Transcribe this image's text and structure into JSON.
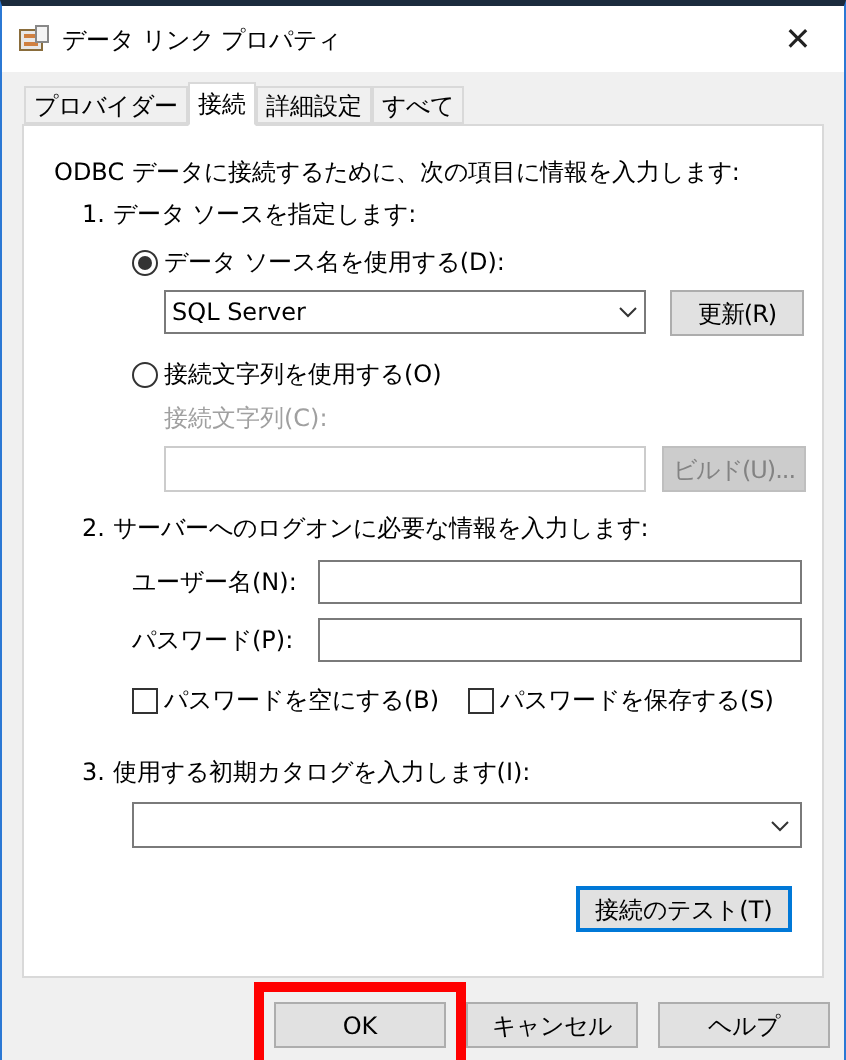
{
  "window": {
    "title": "データ リンク プロパティ",
    "close": "✕"
  },
  "tabs": [
    {
      "label": "プロバイダー",
      "selected": false
    },
    {
      "label": "接続",
      "selected": true
    },
    {
      "label": "詳細設定",
      "selected": false
    },
    {
      "label": "すべて",
      "selected": false
    }
  ],
  "intro": "ODBC データに接続するために、次の項目に情報を入力します:",
  "step1": {
    "title": "1. データ ソースを指定します:",
    "dsn_option": {
      "label": "データ ソース名を使用する(D):",
      "selected": true
    },
    "dsn_combo": {
      "value": "SQL Server",
      "disabled": false
    },
    "refresh_button": {
      "label": "更新(R)",
      "disabled": false
    },
    "connstr_option": {
      "label": "接続文字列を使用する(O)",
      "selected": false
    },
    "connstr_label": {
      "text": "接続文字列(C):",
      "disabled": true
    },
    "connstr_field": {
      "disabled": true
    },
    "build_button": {
      "label": "ビルド(U)...",
      "disabled": true
    }
  },
  "step2": {
    "title": "2. サーバーへのログオンに必要な情報を入力します:",
    "fields": [
      {
        "label": "ユーザー名(N):"
      },
      {
        "label": "パスワード(P):"
      }
    ],
    "checkboxes": [
      {
        "label": "パスワードを空にする(B)",
        "checked": false
      },
      {
        "label": "パスワードを保存する(S)",
        "checked": false
      }
    ]
  },
  "step3": {
    "title": "3. 使用する初期カタログを入力します(I):"
  },
  "test_button": {
    "label": "接続のテスト(T)",
    "focused": true
  },
  "buttons": [
    {
      "label": "OK",
      "highlighted": true
    },
    {
      "label": "キャンセル",
      "highlighted": false
    },
    {
      "label": "ヘルプ",
      "highlighted": false
    }
  ]
}
